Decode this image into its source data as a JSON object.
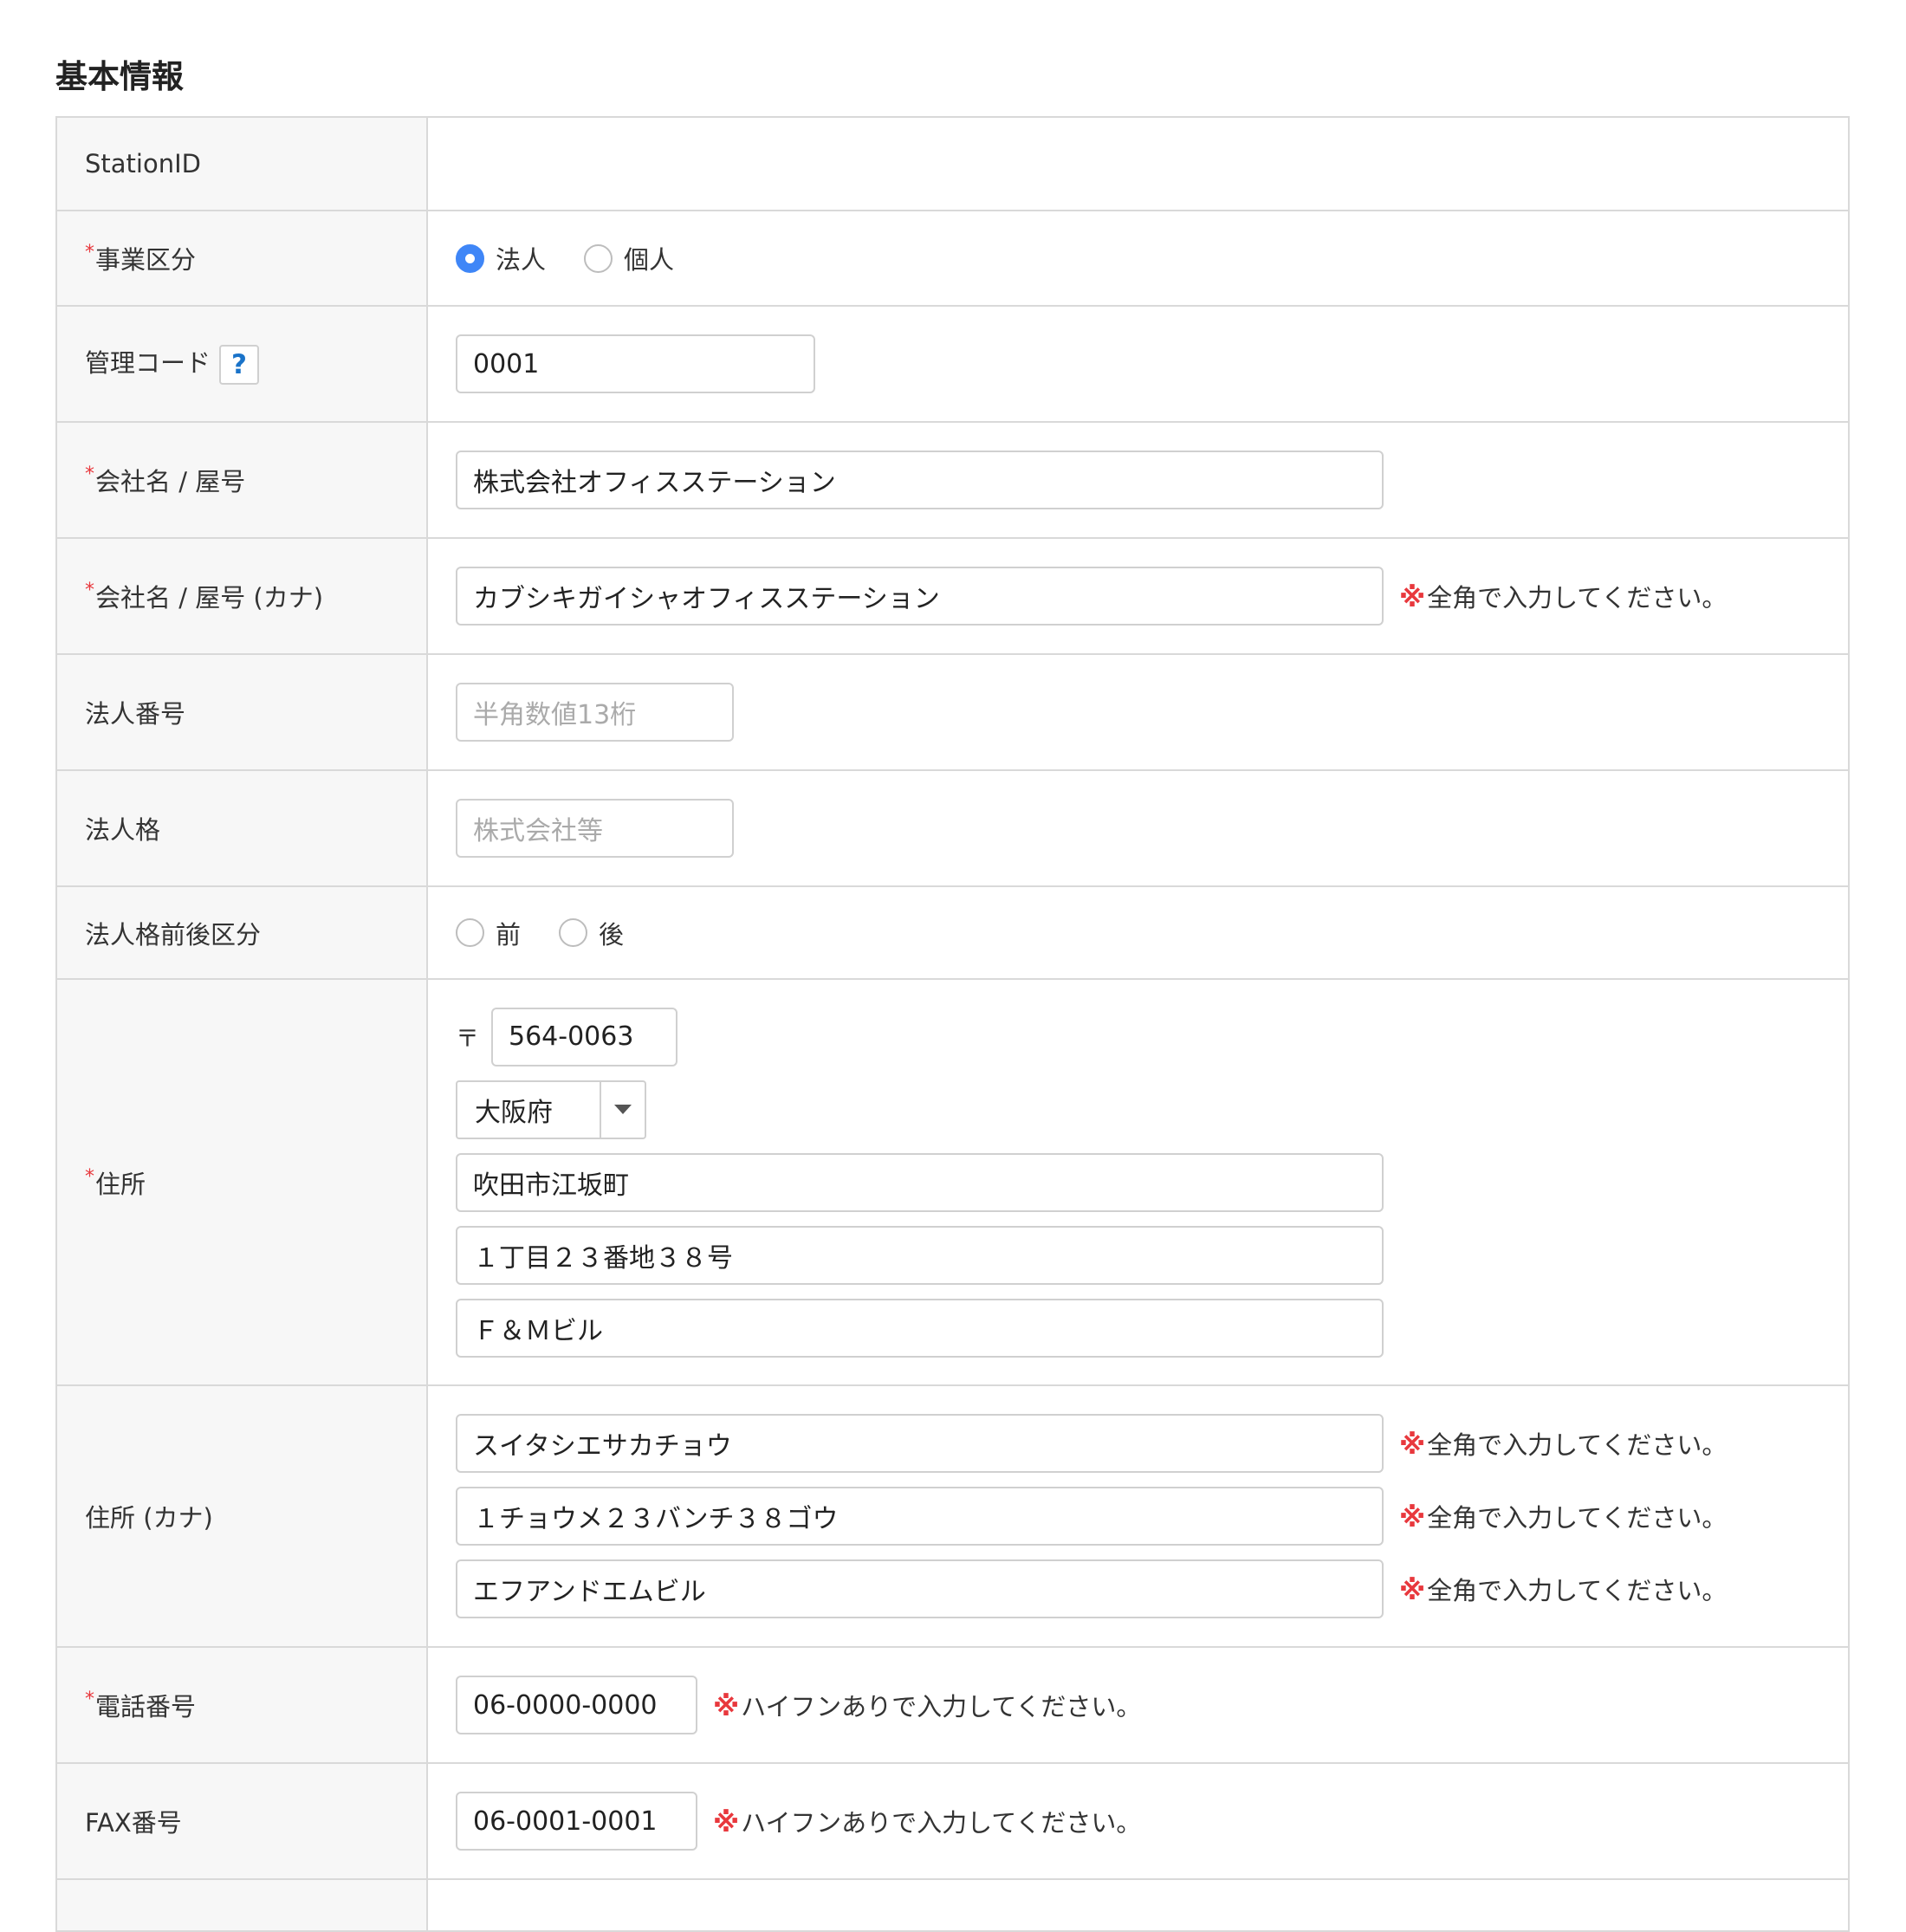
{
  "section": {
    "title": "基本情報"
  },
  "required_mark": "*",
  "note_mark": "※",
  "rows": {
    "station_id": {
      "label": "StationID",
      "value": ""
    },
    "business_type": {
      "label": "事業区分",
      "options": [
        {
          "label": "法人",
          "checked": true
        },
        {
          "label": "個人",
          "checked": false
        }
      ]
    },
    "management_code": {
      "label": "管理コード",
      "help": "?",
      "value": "0001"
    },
    "company_name": {
      "label": "会社名 / 屋号",
      "value": "株式会社オフィスステーション"
    },
    "company_name_kana": {
      "label": "会社名 / 屋号 (カナ)",
      "value": "カブシキガイシャオフィスステーション",
      "note": "全角で入力してください。"
    },
    "corporate_number": {
      "label": "法人番号",
      "placeholder": "半角数値13桁"
    },
    "corporate_type": {
      "label": "法人格",
      "placeholder": "株式会社等"
    },
    "corporate_position": {
      "label": "法人格前後区分",
      "options": [
        {
          "label": "前",
          "checked": false
        },
        {
          "label": "後",
          "checked": false
        }
      ]
    },
    "address": {
      "label": "住所",
      "zip_mark": "〒",
      "zip": "564-0063",
      "prefecture": "大阪府",
      "line1": "吹田市江坂町",
      "line2": "１丁目２３番地３８号",
      "line3": "Ｆ＆Ｍビル"
    },
    "address_kana": {
      "label": "住所 (カナ)",
      "line1": "スイタシエサカチョウ",
      "line2": "１チョウメ２３バンチ３８ゴウ",
      "line3": "エフアンドエムビル",
      "note": "全角で入力してください。"
    },
    "phone": {
      "label": "電話番号",
      "value": "06-0000-0000",
      "note": "ハイフンありで入力してください。"
    },
    "fax": {
      "label": "FAX番号",
      "value": "06-0001-0001",
      "note": "ハイフンありで入力してください。"
    }
  },
  "colors": {
    "accent": "#3f86f7",
    "required": "#e8383d",
    "help": "#1a73c9",
    "label_bg": "#f7f7f7",
    "border": "#d9d9d9"
  }
}
